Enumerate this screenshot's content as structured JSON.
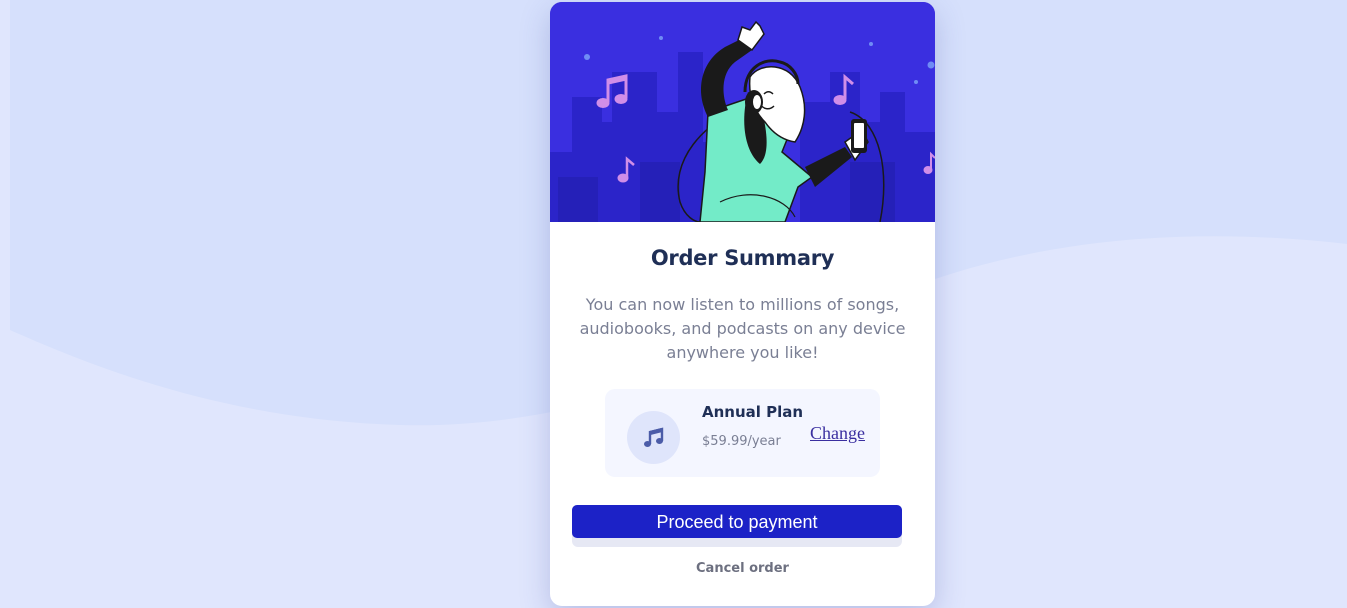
{
  "colors": {
    "page_background": "#e0e6fd",
    "wave_background": "#d6e0fc",
    "hero_background": "#3a2fe0",
    "primary_button": "#1c22c7",
    "plan_box_background": "#f4f6ff"
  },
  "hero": {
    "illustration": "person-with-headphones-dancing-illustration"
  },
  "order": {
    "title": "Order Summary",
    "description": "You can now listen to millions of songs, audiobooks, and podcasts on any device anywhere you like!"
  },
  "plan": {
    "icon": "music-note-icon",
    "name": "Annual Plan",
    "price": "$59.99/year",
    "change_label": "Change"
  },
  "actions": {
    "proceed_label": "Proceed to payment",
    "cancel_label": "Cancel order"
  }
}
